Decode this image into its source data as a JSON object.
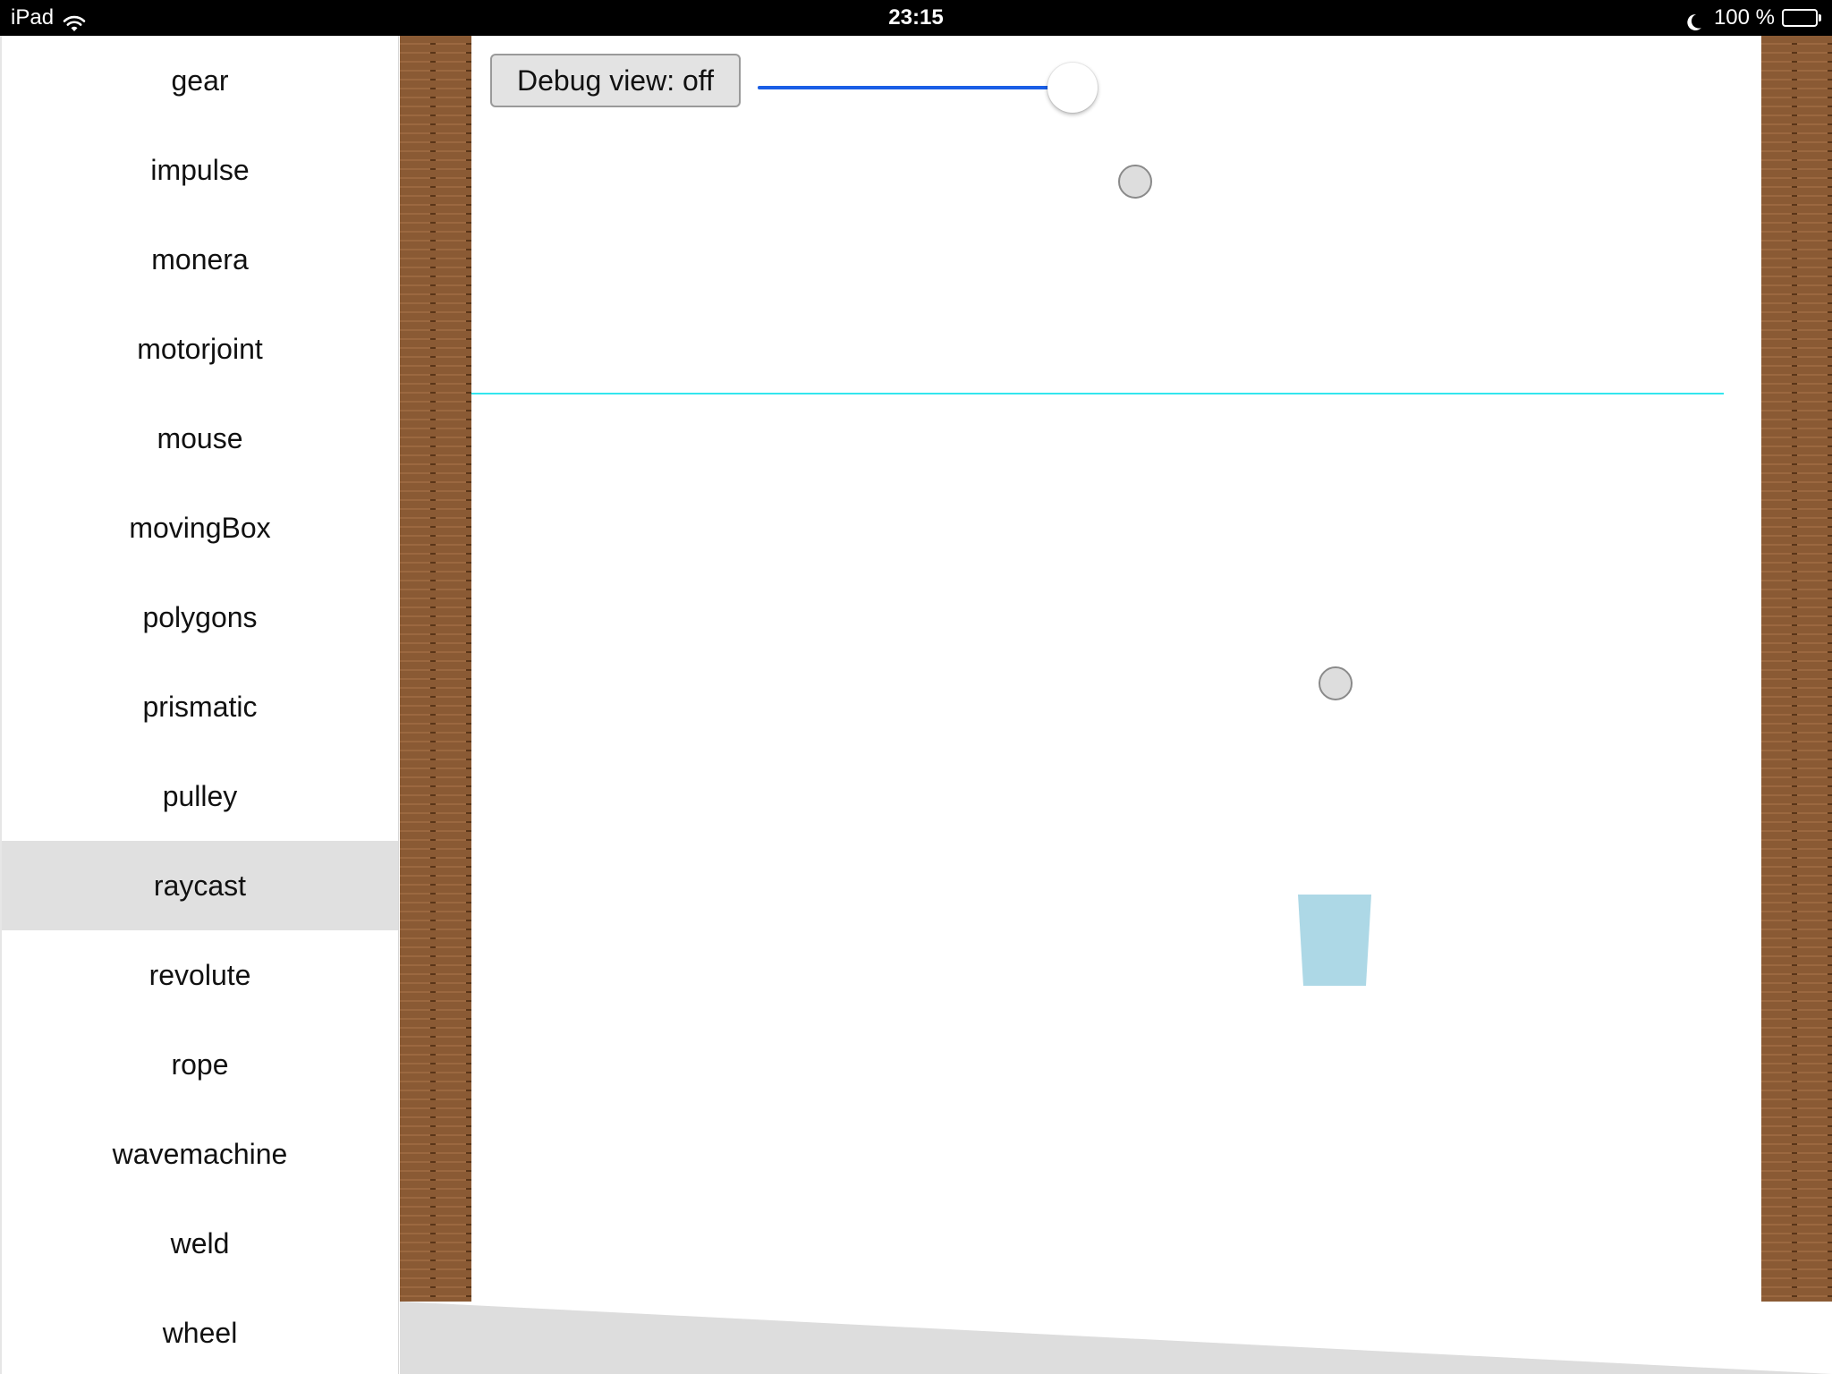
{
  "status_bar": {
    "device": "iPad",
    "time": "23:15",
    "battery": "100 %",
    "battery_level": 1.0,
    "icons": [
      "wifi-icon",
      "moon-icon",
      "battery-icon"
    ]
  },
  "sidebar": {
    "items": [
      {
        "label": "gear"
      },
      {
        "label": "impulse"
      },
      {
        "label": "monera"
      },
      {
        "label": "motorjoint"
      },
      {
        "label": "mouse"
      },
      {
        "label": "movingBox"
      },
      {
        "label": "polygons"
      },
      {
        "label": "prismatic"
      },
      {
        "label": "pulley"
      },
      {
        "label": "raycast",
        "selected": true
      },
      {
        "label": "revolute"
      },
      {
        "label": "rope"
      },
      {
        "label": "wavemachine"
      },
      {
        "label": "weld"
      },
      {
        "label": "wheel"
      }
    ],
    "selected_index": 9,
    "selected_color": "#e0e0e0"
  },
  "scene": {
    "debug_button_label": "Debug view: off",
    "slider": {
      "value": 1.0,
      "fill_color": "#1a5ee6"
    },
    "colors": {
      "raycast_line": "#33e6ee",
      "ball": "#dddddd",
      "bucket": "#add8e6",
      "floor": "#dddddd",
      "brick_light": "#9b6840",
      "brick_dark": "#5a3518"
    }
  }
}
